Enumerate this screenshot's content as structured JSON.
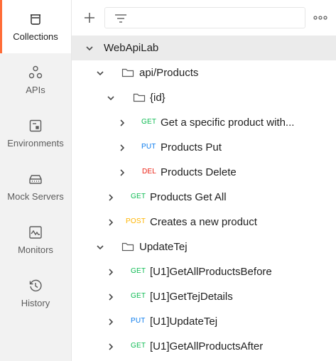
{
  "sidebar": {
    "items": [
      {
        "label": "Collections",
        "icon": "collections-icon",
        "active": true
      },
      {
        "label": "APIs",
        "icon": "apis-icon"
      },
      {
        "label": "Environments",
        "icon": "environments-icon"
      },
      {
        "label": "Mock Servers",
        "icon": "mock-servers-icon"
      },
      {
        "label": "Monitors",
        "icon": "monitors-icon"
      },
      {
        "label": "History",
        "icon": "history-icon"
      }
    ]
  },
  "toolbar": {
    "search_value": "",
    "add_icon": "plus-icon",
    "filter_icon": "filter-icon",
    "more_icon": "more-horizontal-icon"
  },
  "colors": {
    "accent": "#ff6c37",
    "get": "#0cbb52",
    "put": "#097bed",
    "delete": "#eb2013",
    "post": "#ffb400"
  },
  "tree": {
    "rows": [
      {
        "type": "collection",
        "label": "WebApiLab",
        "expanded": true
      },
      {
        "type": "folder",
        "label": "api/Products",
        "expanded": true
      },
      {
        "type": "folder",
        "label": "{id}",
        "expanded": true
      },
      {
        "type": "request",
        "method": "GET",
        "label": "Get a specific product with..."
      },
      {
        "type": "request",
        "method": "PUT",
        "label": "Products Put"
      },
      {
        "type": "request",
        "method": "DEL",
        "label": "Products Delete"
      },
      {
        "type": "request",
        "method": "GET",
        "label": "Products Get All"
      },
      {
        "type": "request",
        "method": "POST",
        "label": "Creates a new product"
      },
      {
        "type": "folder",
        "label": "UpdateTej",
        "expanded": true
      },
      {
        "type": "request",
        "method": "GET",
        "label": "[U1]GetAllProductsBefore"
      },
      {
        "type": "request",
        "method": "GET",
        "label": "[U1]GetTejDetails"
      },
      {
        "type": "request",
        "method": "PUT",
        "label": "[U1]UpdateTej"
      },
      {
        "type": "request",
        "method": "GET",
        "label": "[U1]GetAllProductsAfter"
      }
    ]
  }
}
